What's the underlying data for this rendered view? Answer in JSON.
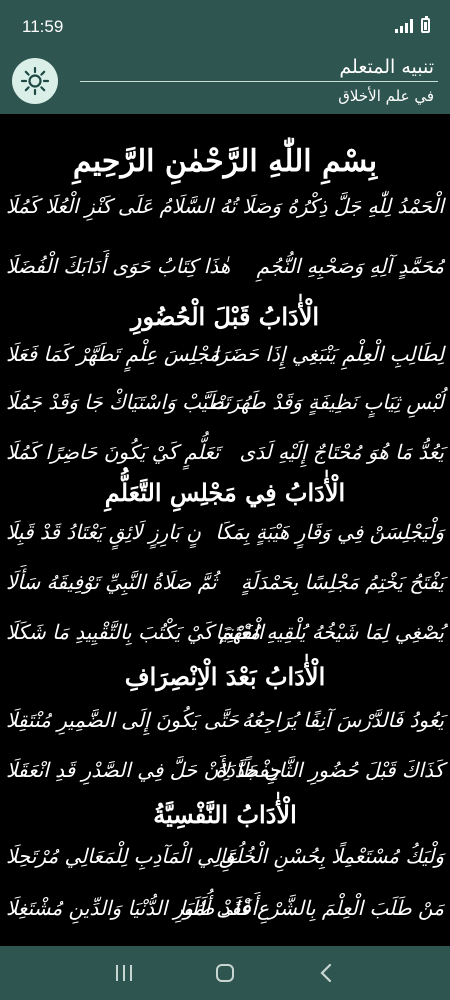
{
  "status": {
    "time": "11:59"
  },
  "appbar": {
    "title": "تنبيه المتعلم",
    "subtitle": "في علم الأخلاق",
    "theme_icon": "sun-icon"
  },
  "poem": {
    "basmala": "بِسْمِ اللّٰهِ الرَّحْمٰنِ الرَّحِيمِ",
    "sections": [
      {
        "heading": "",
        "verses": [
          [
            "تُهُ السَّلَامُ عَلَى كَنْزِ الْعُلَا كَمُلَا",
            "الْحَمْدُ لِلّٰهِ جَلَّ ذِكْرُهُ وَصَلَا"
          ],
          [
            "هٰذَا كِتَابُ حَوَى أَدَابَكَ الْفُضَلَا",
            "مُحَمَّدٍ آلِهِ وَصَحْبِهِ النُّجُمِ"
          ]
        ]
      },
      {
        "heading": "الْأٰدَابُ قَبْلَ الْحُضُورِ",
        "verses": [
          [
            "مَجْلِسَ عِلْمٍ تَطَهَّرْ كَمَا فَعَلَا",
            "لِطَالِبِ الْعِلْمِ يَنْبَغِي إِذَا حَضَرَا"
          ],
          [
            "تَطَيَّبْ وَاسْتَيَاكْ جَا وَقَدْ جَمُلَا",
            "لُبْسِ ثِيَابٍ نَظِيفَةٍ وَقَدْ طَهُرَتْ"
          ],
          [
            "تَعَلُّمٍ كَيْ يَكُونَ حَاضِرًا كَمُلَا",
            "يَعُدُّ مَا هُوَ مُحْتَاجٌ إِلَيْهِ لَدَى"
          ]
        ]
      },
      {
        "heading": "الْأٰدَابُ فِي مَجْلِسِ التَّعَلُّمِ",
        "verses": [
          [
            "نٍ بَارِزٍ لَائِقٍ يَعْتَادُ قَدْ قَبِلَا",
            "وَلْيَجْلِسَنْ فِي وَقَارٍ هَيْبَةٍ بِمَكَا"
          ],
          [
            "ثُمَّ صَلَاةُ النَّبِيِّ تَوْفِيقَهُ سَأَلَا",
            "يَفْتَحُ يَخْتِمُ مَجْلِسًا بِحَمْدَلَةٍ"
          ],
          [
            "الْفَهْمَ كَيْ يَكْتُبَ بِالتَّقْيِيدِ مَا شَكَلَا",
            "يُصْغِي لِمَا شَيْخُهُ يُلْقِيهِ مُعْتَنِيَا"
          ]
        ]
      },
      {
        "heading": "الْأٰدَابُ بَعْدَ الْاِنْصِرَافِ",
        "verses": [
          [
            "حَتَّى يَكُونَ إِلَى الضَّمِيرِ مُنْتَقِلَا",
            "يَعُودُ فَالدَّرْسَ آنِفًا يُرَاجِعُهُ"
          ],
          [
            "حِفْظًا لِأَنْ حَلَّ فِي الصَّدْرِ قَدِ انْعَقَلَا",
            "كَذَاكَ قَبْلَ حُضُورِ الثَّانِ جَدَّدَهُ"
          ]
        ]
      },
      {
        "heading": "الْأٰدَابُ النَّفْسِيَّةُ",
        "verses": [
          [
            "عَالِي الْمَآدِبِ لِلْمَعَالِي مُرْتَحِلَا",
            "وَلْيَكُ مُسْتَعْمِلًا بِحُسْنِ الْخُلُقِ"
          ],
          [
            "أَعْلَى أُمُورِ الدُّنْيَا وَالدِّينِ مُشْتَغِلَا",
            "مَنْ طَلَبَ الْعِلْمَ بِالشَّرْعِ فَقَدْ طَلَبَا"
          ]
        ]
      }
    ]
  },
  "navbar": {
    "icons": [
      "recents-icon",
      "home-icon",
      "back-icon"
    ]
  }
}
